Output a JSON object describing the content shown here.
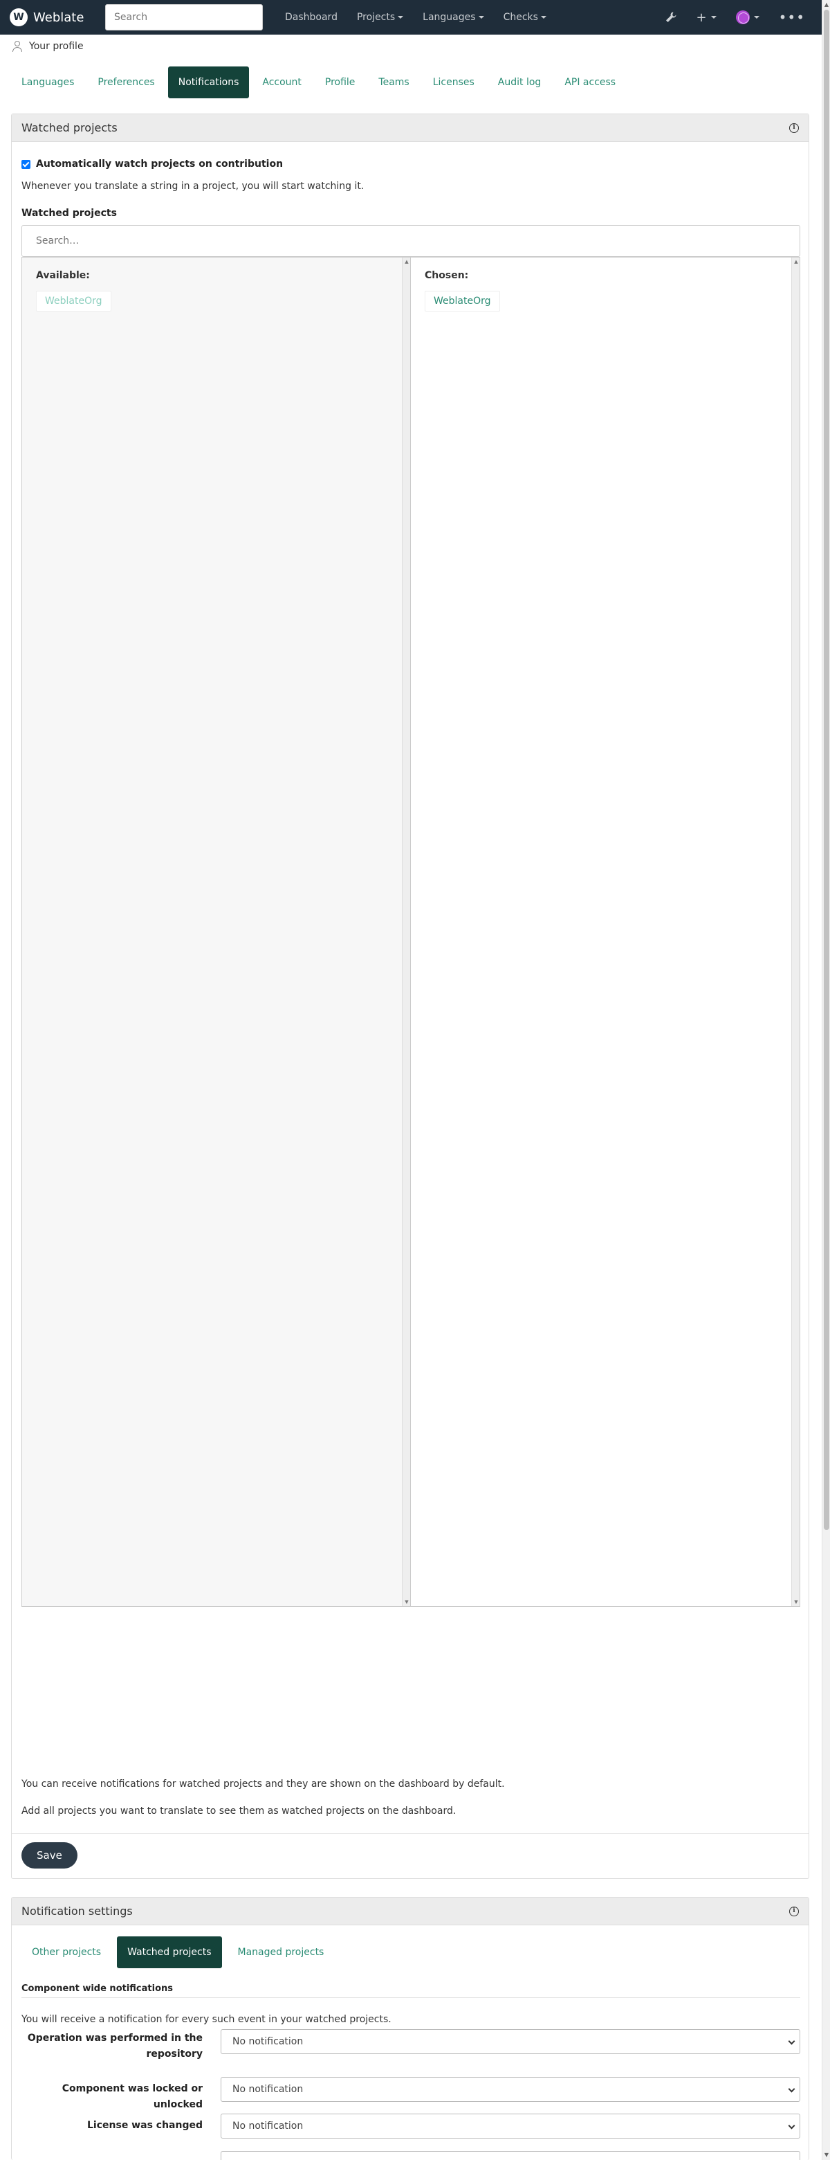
{
  "navbar": {
    "brand": "Weblate",
    "search_placeholder": "Search",
    "links": [
      "Dashboard",
      "Projects",
      "Languages",
      "Checks"
    ]
  },
  "breadcrumb": {
    "label": "Your profile"
  },
  "tabs": [
    "Languages",
    "Preferences",
    "Notifications",
    "Account",
    "Profile",
    "Teams",
    "Licenses",
    "Audit log",
    "API access"
  ],
  "watched": {
    "title": "Watched projects",
    "auto_watch_label": "Automatically watch projects on contribution",
    "auto_watch_help": "Whenever you translate a string in a project, you will start watching it.",
    "field_label": "Watched projects",
    "search_placeholder": "Search…",
    "available_label": "Available:",
    "available_items": [
      "WeblateOrg"
    ],
    "chosen_label": "Chosen:",
    "chosen_items": [
      "WeblateOrg"
    ],
    "help1": "You can receive notifications for watched projects and they are shown on the dashboard by default.",
    "help2": "Add all projects you want to translate to see them as watched projects on the dashboard.",
    "save_label": "Save"
  },
  "notifications": {
    "title": "Notification settings",
    "subtabs": [
      "Other projects",
      "Watched projects",
      "Managed projects"
    ],
    "section_title": "Component wide notifications",
    "section_help": "You will receive a notification for every such event in your watched projects.",
    "rows": [
      {
        "label": "Operation was performed in the repository",
        "value": "No notification"
      },
      {
        "label": "Component was locked or unlocked",
        "value": "No notification"
      },
      {
        "label": "License was changed",
        "value": "No notification"
      }
    ]
  },
  "colors": {
    "navbar": "#1f2d3a",
    "accent": "#2a8c74",
    "active_tab": "#14433a",
    "button": "#2d3b48"
  }
}
